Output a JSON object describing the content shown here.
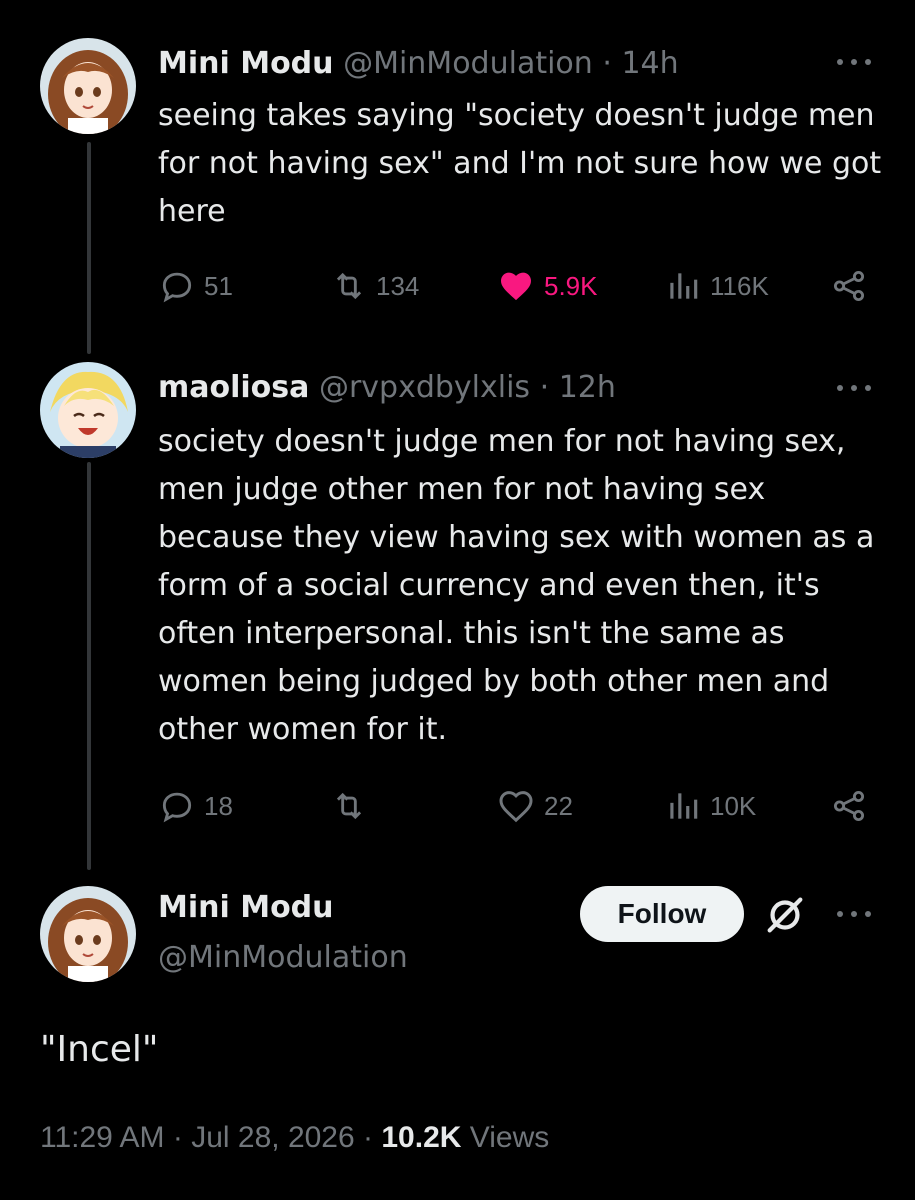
{
  "tweets": [
    {
      "name": "Mini Modu",
      "handle": "@MinModulation",
      "separator": "·",
      "time": "14h",
      "text": "seeing takes saying \"society doesn't judge men for not having sex\" and I'm not sure how we got here",
      "replies": "51",
      "retweets": "134",
      "likes": "5.9K",
      "views": "116K",
      "liked": true
    },
    {
      "name": "maoliosa",
      "handle": "@rvpxdbylxlis",
      "separator": "·",
      "time": "12h",
      "text": "society doesn't judge men for not having sex, men judge other men for not having sex because they view having sex with women as a form of a social currency and even then, it's often interpersonal. this isn't the same as women being judged by both other men and other women for it.",
      "replies": "18",
      "retweets": "",
      "likes": "22",
      "views": "10K",
      "liked": false
    }
  ],
  "main_tweet": {
    "name": "Mini Modu",
    "handle": "@MinModulation",
    "follow_label": "Follow",
    "text": "\"Incel\"",
    "time": "11:29 AM",
    "separator": "·",
    "date": "Jul 28, 2026",
    "views_count": "10.2K",
    "views_label": "Views"
  },
  "colors": {
    "background": "#000000",
    "text": "#e7e9ea",
    "muted": "#71767b",
    "like": "#f91880"
  },
  "icons": [
    "reply-icon",
    "retweet-icon",
    "like-icon",
    "views-icon",
    "share-icon",
    "more-icon",
    "grok-icon"
  ]
}
